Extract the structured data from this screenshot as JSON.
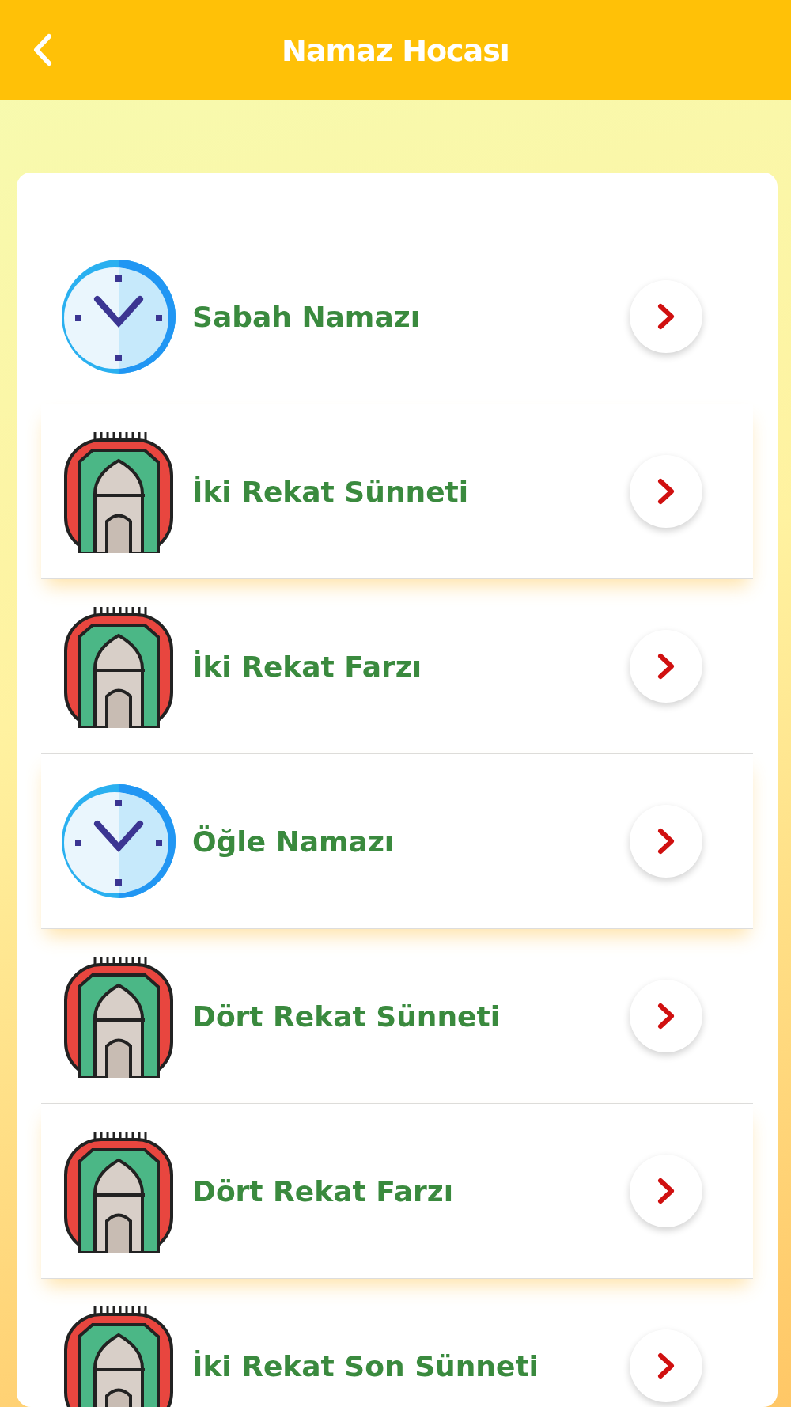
{
  "header": {
    "title": "Namaz Hocası"
  },
  "items": [
    {
      "kind": "clock",
      "label": "Sabah Namazı",
      "raised": false
    },
    {
      "kind": "rug",
      "label": "İki Rekat Sünneti",
      "raised": true
    },
    {
      "kind": "rug",
      "label": "İki Rekat Farzı",
      "raised": false
    },
    {
      "kind": "clock",
      "label": "Öğle Namazı",
      "raised": true
    },
    {
      "kind": "rug",
      "label": "Dört Rekat Sünneti",
      "raised": false
    },
    {
      "kind": "rug",
      "label": "Dört Rekat Farzı",
      "raised": true
    },
    {
      "kind": "rug",
      "label": "İki Rekat Son Sünneti",
      "raised": false
    }
  ]
}
